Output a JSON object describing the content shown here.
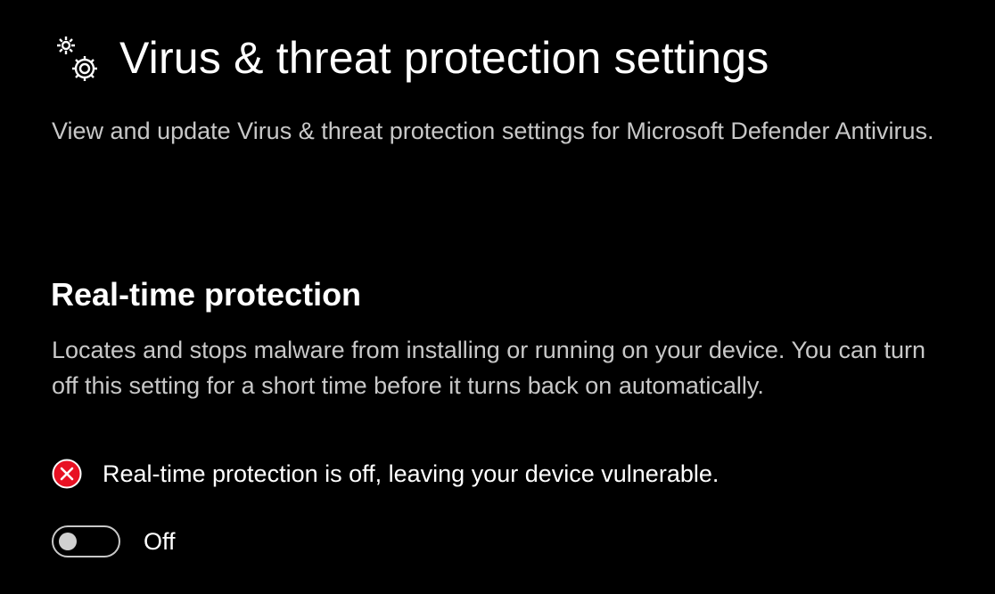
{
  "header": {
    "icon": "gears-icon",
    "title": "Virus & threat protection settings"
  },
  "subtitle": "View and update Virus & threat protection settings for Microsoft Defender Antivirus.",
  "realtime": {
    "title": "Real-time protection",
    "description": "Locates and stops malware from installing or running on your device. You can turn off this setting for a short time before it turns back on automatically.",
    "status": {
      "icon": "error-circle-icon",
      "color": "#e81123",
      "text": "Real-time protection is off, leaving your device vulnerable."
    },
    "toggle": {
      "state": "off",
      "label": "Off"
    }
  }
}
